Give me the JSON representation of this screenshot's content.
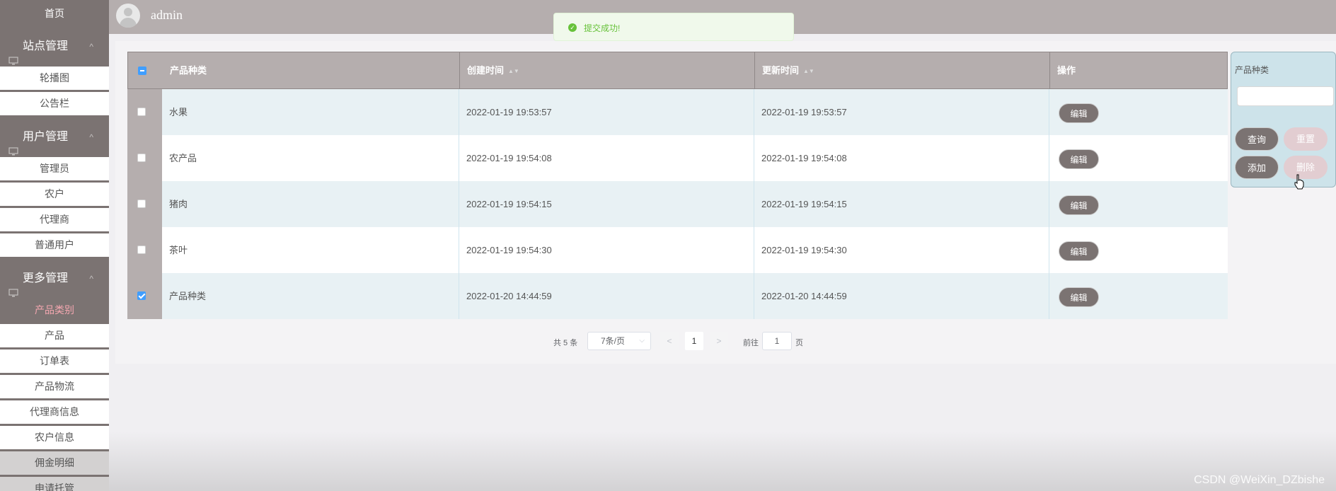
{
  "sidebar": {
    "home": "首页",
    "groups": [
      {
        "label": "站点管理",
        "items": [
          "轮播图",
          "公告栏"
        ]
      },
      {
        "label": "用户管理",
        "items": [
          "管理员",
          "农户",
          "代理商",
          "普通用户"
        ]
      },
      {
        "label": "更多管理",
        "items": [
          "产品类别",
          "产品",
          "订单表",
          "产品物流",
          "代理商信息",
          "农户信息",
          "佣金明细",
          "申请托管"
        ]
      }
    ],
    "active_item": "产品类别",
    "chevron": "^"
  },
  "header": {
    "username": "admin"
  },
  "toast": {
    "message": "提交成功!"
  },
  "table": {
    "columns": [
      "产品种类",
      "创建时间",
      "更新时间",
      "操作"
    ],
    "sort_glyph": "▲▼",
    "edit_label": "编辑",
    "rows": [
      {
        "checked": false,
        "category": "水果",
        "created": "2022-01-19 19:53:57",
        "updated": "2022-01-19 19:53:57"
      },
      {
        "checked": false,
        "category": "农产品",
        "created": "2022-01-19 19:54:08",
        "updated": "2022-01-19 19:54:08"
      },
      {
        "checked": false,
        "category": "猪肉",
        "created": "2022-01-19 19:54:15",
        "updated": "2022-01-19 19:54:15"
      },
      {
        "checked": false,
        "category": "茶叶",
        "created": "2022-01-19 19:54:30",
        "updated": "2022-01-19 19:54:30"
      },
      {
        "checked": true,
        "category": "产品种类",
        "created": "2022-01-20 14:44:59",
        "updated": "2022-01-20 14:44:59"
      }
    ]
  },
  "pagination": {
    "total": "共 5 条",
    "page_size": "7条/页",
    "prev": "<",
    "current": "1",
    "next": ">",
    "goto_label": "前往",
    "goto_value": "1",
    "page_suffix": "页"
  },
  "search": {
    "label": "产品种类",
    "query": "查询",
    "reset": "重置",
    "add": "添加",
    "delete": "删除"
  },
  "watermark": "CSDN @WeiXin_DZbishe",
  "colors": {
    "sidebar": "#7b7372",
    "header": "#b5aeae",
    "active_text": "#f4a7b0",
    "row_stripe": "#e8f1f4",
    "toast_green": "#67c23a"
  }
}
